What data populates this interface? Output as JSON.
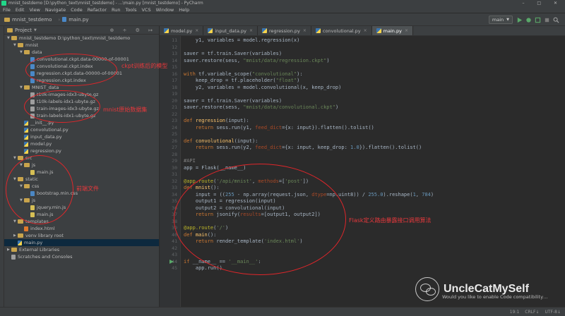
{
  "window": {
    "title": "mnist_testdemo [D:\\python_text\\mnist_testdemo] - ...\\main.py [mnist_testdemo] - PyCharm",
    "controls": "– □ ✕"
  },
  "menu": [
    "File",
    "Edit",
    "View",
    "Navigate",
    "Code",
    "Refactor",
    "Run",
    "Tools",
    "VCS",
    "Window",
    "Help"
  ],
  "breadcrumb": [
    "mnist_testdemo",
    "main.py"
  ],
  "toolbar": {
    "run_config": "main"
  },
  "project": {
    "header": "Project",
    "tree": [
      {
        "indent": 0,
        "arrow": "▼",
        "icon": "folder",
        "label": "mnist_testdemo  D:\\python_text\\mnist_testdemo"
      },
      {
        "indent": 1,
        "arrow": "▼",
        "icon": "folder",
        "label": "mnist"
      },
      {
        "indent": 2,
        "arrow": "▼",
        "icon": "folder",
        "label": "data"
      },
      {
        "indent": 3,
        "arrow": "",
        "icon": "file",
        "label": "convolutional.ckpt.data-00000-of-00001"
      },
      {
        "indent": 3,
        "arrow": "",
        "icon": "file",
        "label": "convolutional.ckpt.index"
      },
      {
        "indent": 3,
        "arrow": "",
        "icon": "file",
        "label": "regression.ckpt.data-00000-of-00001"
      },
      {
        "indent": 3,
        "arrow": "",
        "icon": "file",
        "label": "regression.ckpt.index"
      },
      {
        "indent": 2,
        "arrow": "▼",
        "icon": "folder",
        "label": "MNIST_data"
      },
      {
        "indent": 3,
        "arrow": "",
        "icon": "gz",
        "label": "t10k-images-idx3-ubyte.gz"
      },
      {
        "indent": 3,
        "arrow": "",
        "icon": "gz",
        "label": "t10k-labels-idx1-ubyte.gz"
      },
      {
        "indent": 3,
        "arrow": "",
        "icon": "gz",
        "label": "train-images-idx3-ubyte.gz"
      },
      {
        "indent": 3,
        "arrow": "",
        "icon": "gz",
        "label": "train-labels-idx1-ubyte.gz"
      },
      {
        "indent": 2,
        "arrow": "",
        "icon": "py",
        "label": "__init__.py"
      },
      {
        "indent": 2,
        "arrow": "",
        "icon": "py",
        "label": "convolutional.py"
      },
      {
        "indent": 2,
        "arrow": "",
        "icon": "py",
        "label": "input_data.py"
      },
      {
        "indent": 2,
        "arrow": "",
        "icon": "py",
        "label": "model.py"
      },
      {
        "indent": 2,
        "arrow": "",
        "icon": "py",
        "label": "regression.py"
      },
      {
        "indent": 1,
        "arrow": "▼",
        "icon": "folder",
        "label": "src"
      },
      {
        "indent": 2,
        "arrow": "▼",
        "icon": "folder",
        "label": "js"
      },
      {
        "indent": 3,
        "arrow": "",
        "icon": "js",
        "label": "main.js"
      },
      {
        "indent": 1,
        "arrow": "▼",
        "icon": "folder",
        "label": "static"
      },
      {
        "indent": 2,
        "arrow": "▼",
        "icon": "folder",
        "label": "css"
      },
      {
        "indent": 3,
        "arrow": "",
        "icon": "css",
        "label": "bootstrap.min.css"
      },
      {
        "indent": 2,
        "arrow": "▼",
        "icon": "folder",
        "label": "js"
      },
      {
        "indent": 3,
        "arrow": "",
        "icon": "js",
        "label": "jquery.min.js"
      },
      {
        "indent": 3,
        "arrow": "",
        "icon": "js",
        "label": "main.js"
      },
      {
        "indent": 1,
        "arrow": "▼",
        "icon": "folder",
        "label": "templates"
      },
      {
        "indent": 2,
        "arrow": "",
        "icon": "html",
        "label": "index.html"
      },
      {
        "indent": 1,
        "arrow": "▶",
        "icon": "folder",
        "label": "venv  library root"
      },
      {
        "indent": 1,
        "arrow": "",
        "icon": "py",
        "label": "main.py",
        "selected": true
      },
      {
        "indent": 0,
        "arrow": "▶",
        "icon": "lib",
        "label": "External Libraries"
      },
      {
        "indent": 0,
        "arrow": "",
        "icon": "scratch",
        "label": "Scratches and Consoles"
      }
    ]
  },
  "tabs": [
    {
      "label": "model.py",
      "active": false
    },
    {
      "label": "input_data.py",
      "active": false
    },
    {
      "label": "regression.py",
      "active": false
    },
    {
      "label": "convolutional.py",
      "active": false
    },
    {
      "label": "main.py",
      "active": true
    }
  ],
  "code": {
    "line_numbers": [
      "11",
      "12",
      "13",
      "14",
      "15",
      "16",
      "17",
      "18",
      "19",
      "20",
      "21",
      "22",
      "23",
      "24",
      "25",
      "26",
      "27",
      "28",
      "29",
      "30",
      "31",
      "32",
      "33",
      "34",
      "35",
      "36",
      "37",
      "38",
      "39",
      "40",
      "41",
      "42",
      "43",
      "44",
      "45"
    ],
    "lines": [
      "    y1, variables = model.regression(x)",
      "",
      "saver = tf.train.Saver(variables)",
      "saver.restore(sess, \"mnist/data/regression.ckpt\")",
      "",
      "with tf.variable_scope(\"convolutional\"):",
      "    keep_drop = tf.placeholder(\"float\")",
      "    y2, variables = model.convolutional(x, keep_drop)",
      "",
      "saver = tf.train.Saver(variables)",
      "saver.restore(sess, \"mnist/data/convolutional.ckpt\")",
      "",
      "def regression(input):",
      "    return sess.run(y1, feed_dict={x: input}).flatten().tolist()",
      "",
      "def convolutional(input):",
      "    return sess.run(y2, feed_dict={x: input, keep_drop: 1.0}).flatten().tolist()",
      "",
      "#API",
      "app = Flask(__name__)",
      "",
      "@app.route('/api/mnist', methods=['post'])",
      "def mnist():",
      "    input = ((255 - np.array(request.json, dtype=np.uint8)) / 255.0).reshape(1, 784)",
      "    output1 = regression(input)",
      "    output2 = convolutional(input)",
      "    return jsonify(results=[output1, output2])",
      "",
      "@app.route('/')",
      "def main():",
      "    return render_template('index.html')",
      "",
      "",
      "if __name__ == '__main__':",
      "    app.run()"
    ]
  },
  "annotations": {
    "ckpt": "ckpt训练后的模型",
    "mnist_data": "mnist原始数据集",
    "frontend": "前端文件",
    "flask": "Flask定义路由暴露接口调用算法"
  },
  "watermark": {
    "text": "UncleCatMySelf"
  },
  "notification": "Would you like to enable Code compatibility…",
  "status": [
    "19:1",
    "CRLF↓",
    "UTF-8↓"
  ]
}
